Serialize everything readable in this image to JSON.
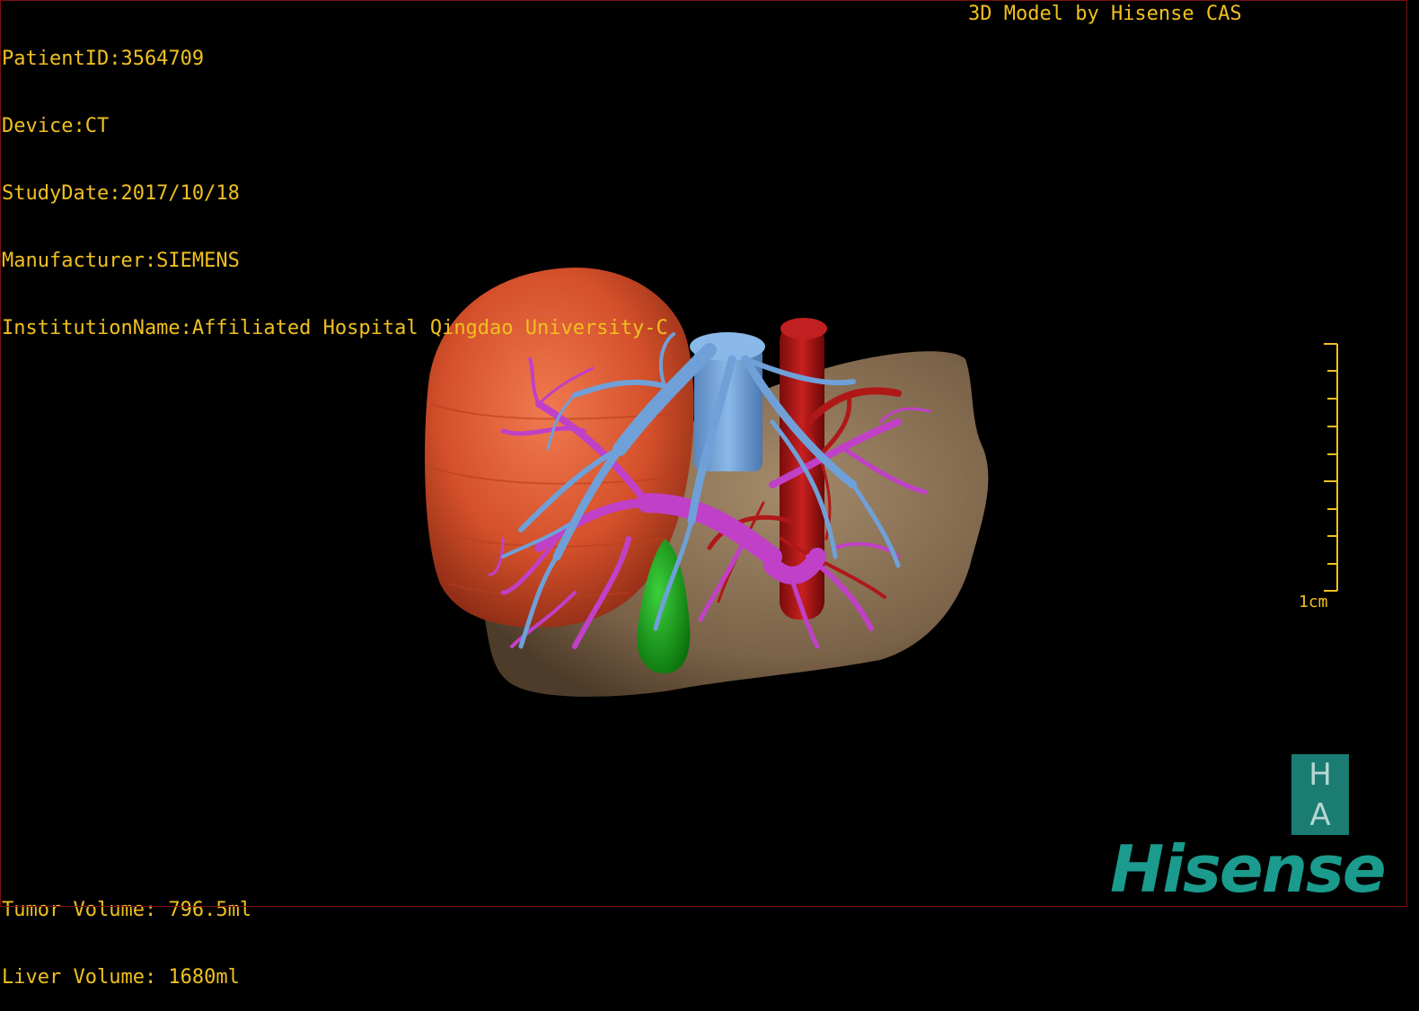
{
  "patient": {
    "id_line": "PatientID:3564709",
    "device_line": "Device:CT",
    "study_date_line": "StudyDate:2017/10/18",
    "manufacturer_line": "Manufacturer:SIEMENS",
    "institution_line": "InstitutionName:Affiliated Hospital Qingdao University-C"
  },
  "header": {
    "model_credit": "3D Model by Hisense CAS"
  },
  "volumes": {
    "tumor_line": "Tumor Volume: 796.5ml",
    "liver_line": "Liver Volume: 1680ml"
  },
  "scale": {
    "label": "1cm"
  },
  "badge": {
    "top_letter": "H",
    "bottom_letter": "A"
  },
  "brand": {
    "name": "Hisense"
  },
  "colors": {
    "overlay_text": "#f0c020",
    "tumor": "#d4502a",
    "liver": "#7a6248",
    "portal_vein": "#c040c8",
    "hepatic_vein": "#6fa0d8",
    "artery": "#b01818",
    "gallbladder": "#1fa01f",
    "brand": "#1a9b8d"
  }
}
